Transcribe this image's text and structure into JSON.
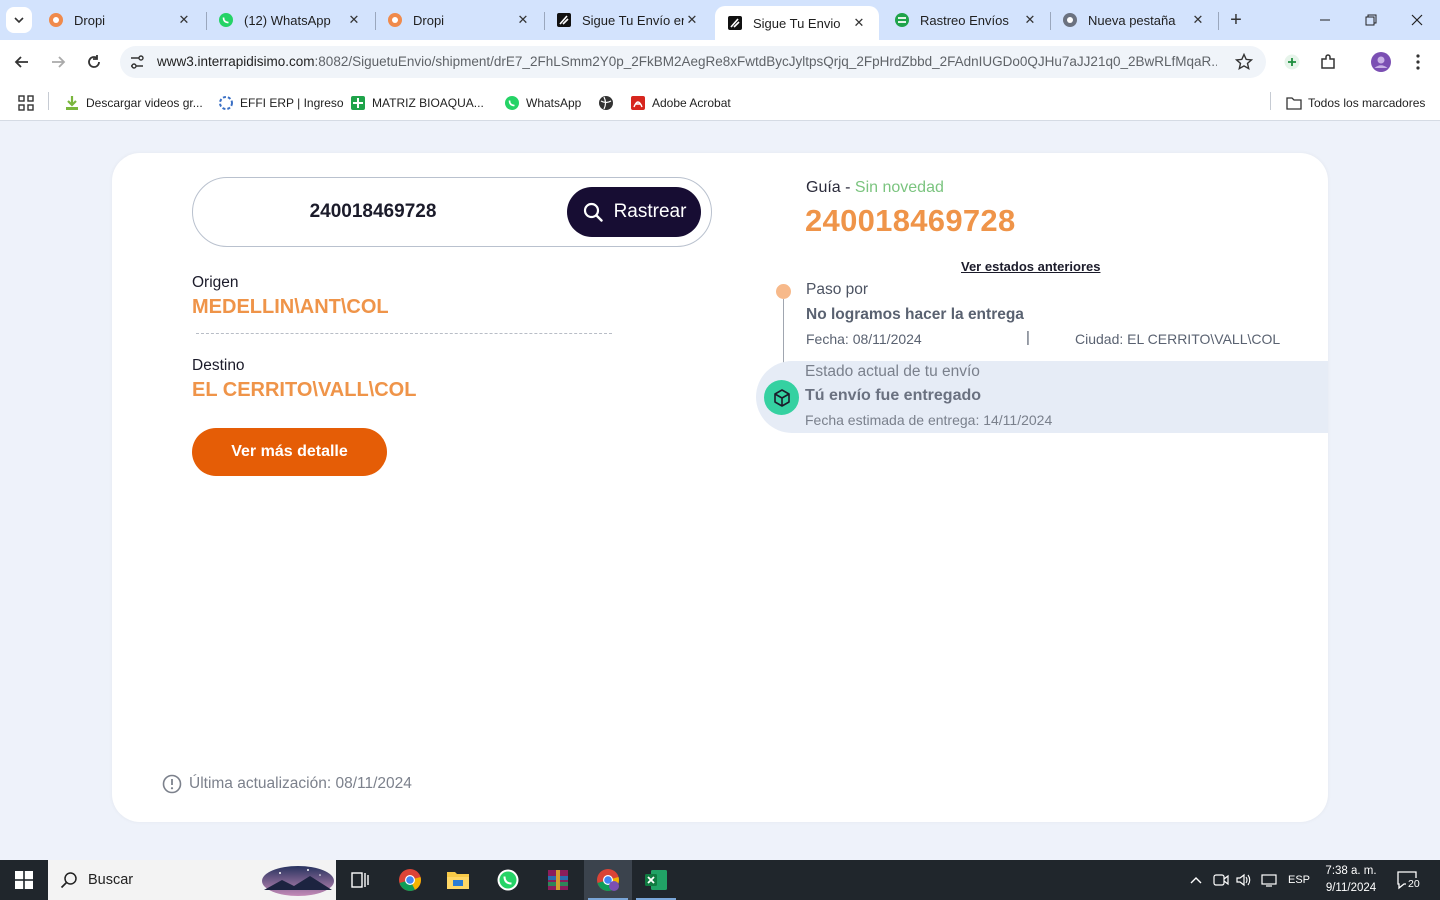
{
  "browser": {
    "tabs": [
      {
        "title": "Dropi",
        "icon": "dropi-icon",
        "active": false
      },
      {
        "title": "(12) WhatsApp",
        "icon": "whatsapp-icon",
        "active": false
      },
      {
        "title": "Dropi",
        "icon": "dropi-icon",
        "active": false
      },
      {
        "title": "Sigue Tu Envío en",
        "icon": "interrapidisimo-icon",
        "active": false
      },
      {
        "title": "Sigue Tu Envio",
        "icon": "interrapidisimo-icon",
        "active": true
      },
      {
        "title": "Rastreo Envíos",
        "icon": "rastreo-icon",
        "active": false
      },
      {
        "title": "Nueva pestaña",
        "icon": "chrome-icon",
        "active": false
      }
    ],
    "url_host": "www3.interrapidisimo.com",
    "url_rest": ":8082/SiguetuEnvio/shipment/drE7_2FhLSmm2Y0p_2FkBM2AegRe8xFwtdBycJyltpsQrjq_2FpHrdZbbd_2FAdnIUGDo0QJHu7aJJ21q0_2BwRLfMqaR...",
    "bookmarks": [
      {
        "label": "Descargar videos gr...",
        "icon": "download-icon"
      },
      {
        "label": "EFFI ERP | Ingreso",
        "icon": "effi-icon"
      },
      {
        "label": "MATRIZ BIOAQUA...",
        "icon": "sheets-icon"
      },
      {
        "label": "WhatsApp",
        "icon": "whatsapp-icon"
      },
      {
        "label": "Adobe Acrobat",
        "icon": "acrobat-icon"
      }
    ],
    "all_bookmarks_label": "Todos los marcadores"
  },
  "tracking": {
    "search_value": "240018469728",
    "track_button": "Rastrear",
    "origin_label": "Origen",
    "origin_value": "MEDELLIN\\ANT\\COL",
    "destination_label": "Destino",
    "destination_value": "EL CERRITO\\VALL\\COL",
    "detail_button": "Ver más detalle",
    "guide_label": "Guía",
    "guide_dash": " - ",
    "guide_status": "Sin novedad",
    "guide_number": "240018469728",
    "previous_states_link": "Ver estados anteriores",
    "step": {
      "title": "Paso por",
      "description": "No logramos hacer la entrega",
      "date": "Fecha: 08/11/2024",
      "separator": "|",
      "city": "Ciudad: EL CERRITO\\VALL\\COL"
    },
    "current": {
      "title": "Estado actual de tu envío",
      "status": "Tú envío fue entregado",
      "estimated": "Fecha estimada de entrega: 14/11/2024"
    },
    "last_update": "Última actualización: 08/11/2024"
  },
  "taskbar": {
    "search_placeholder": "Buscar",
    "language": "ESP",
    "time": "7:38 a. m.",
    "date": "9/11/2024",
    "notifications": "20"
  },
  "colors": {
    "accent_orange": "#ef9449",
    "button_orange": "#e55d06",
    "button_dark": "#170d33",
    "status_green": "#7bc47f",
    "badge_green": "#35d1a1"
  }
}
